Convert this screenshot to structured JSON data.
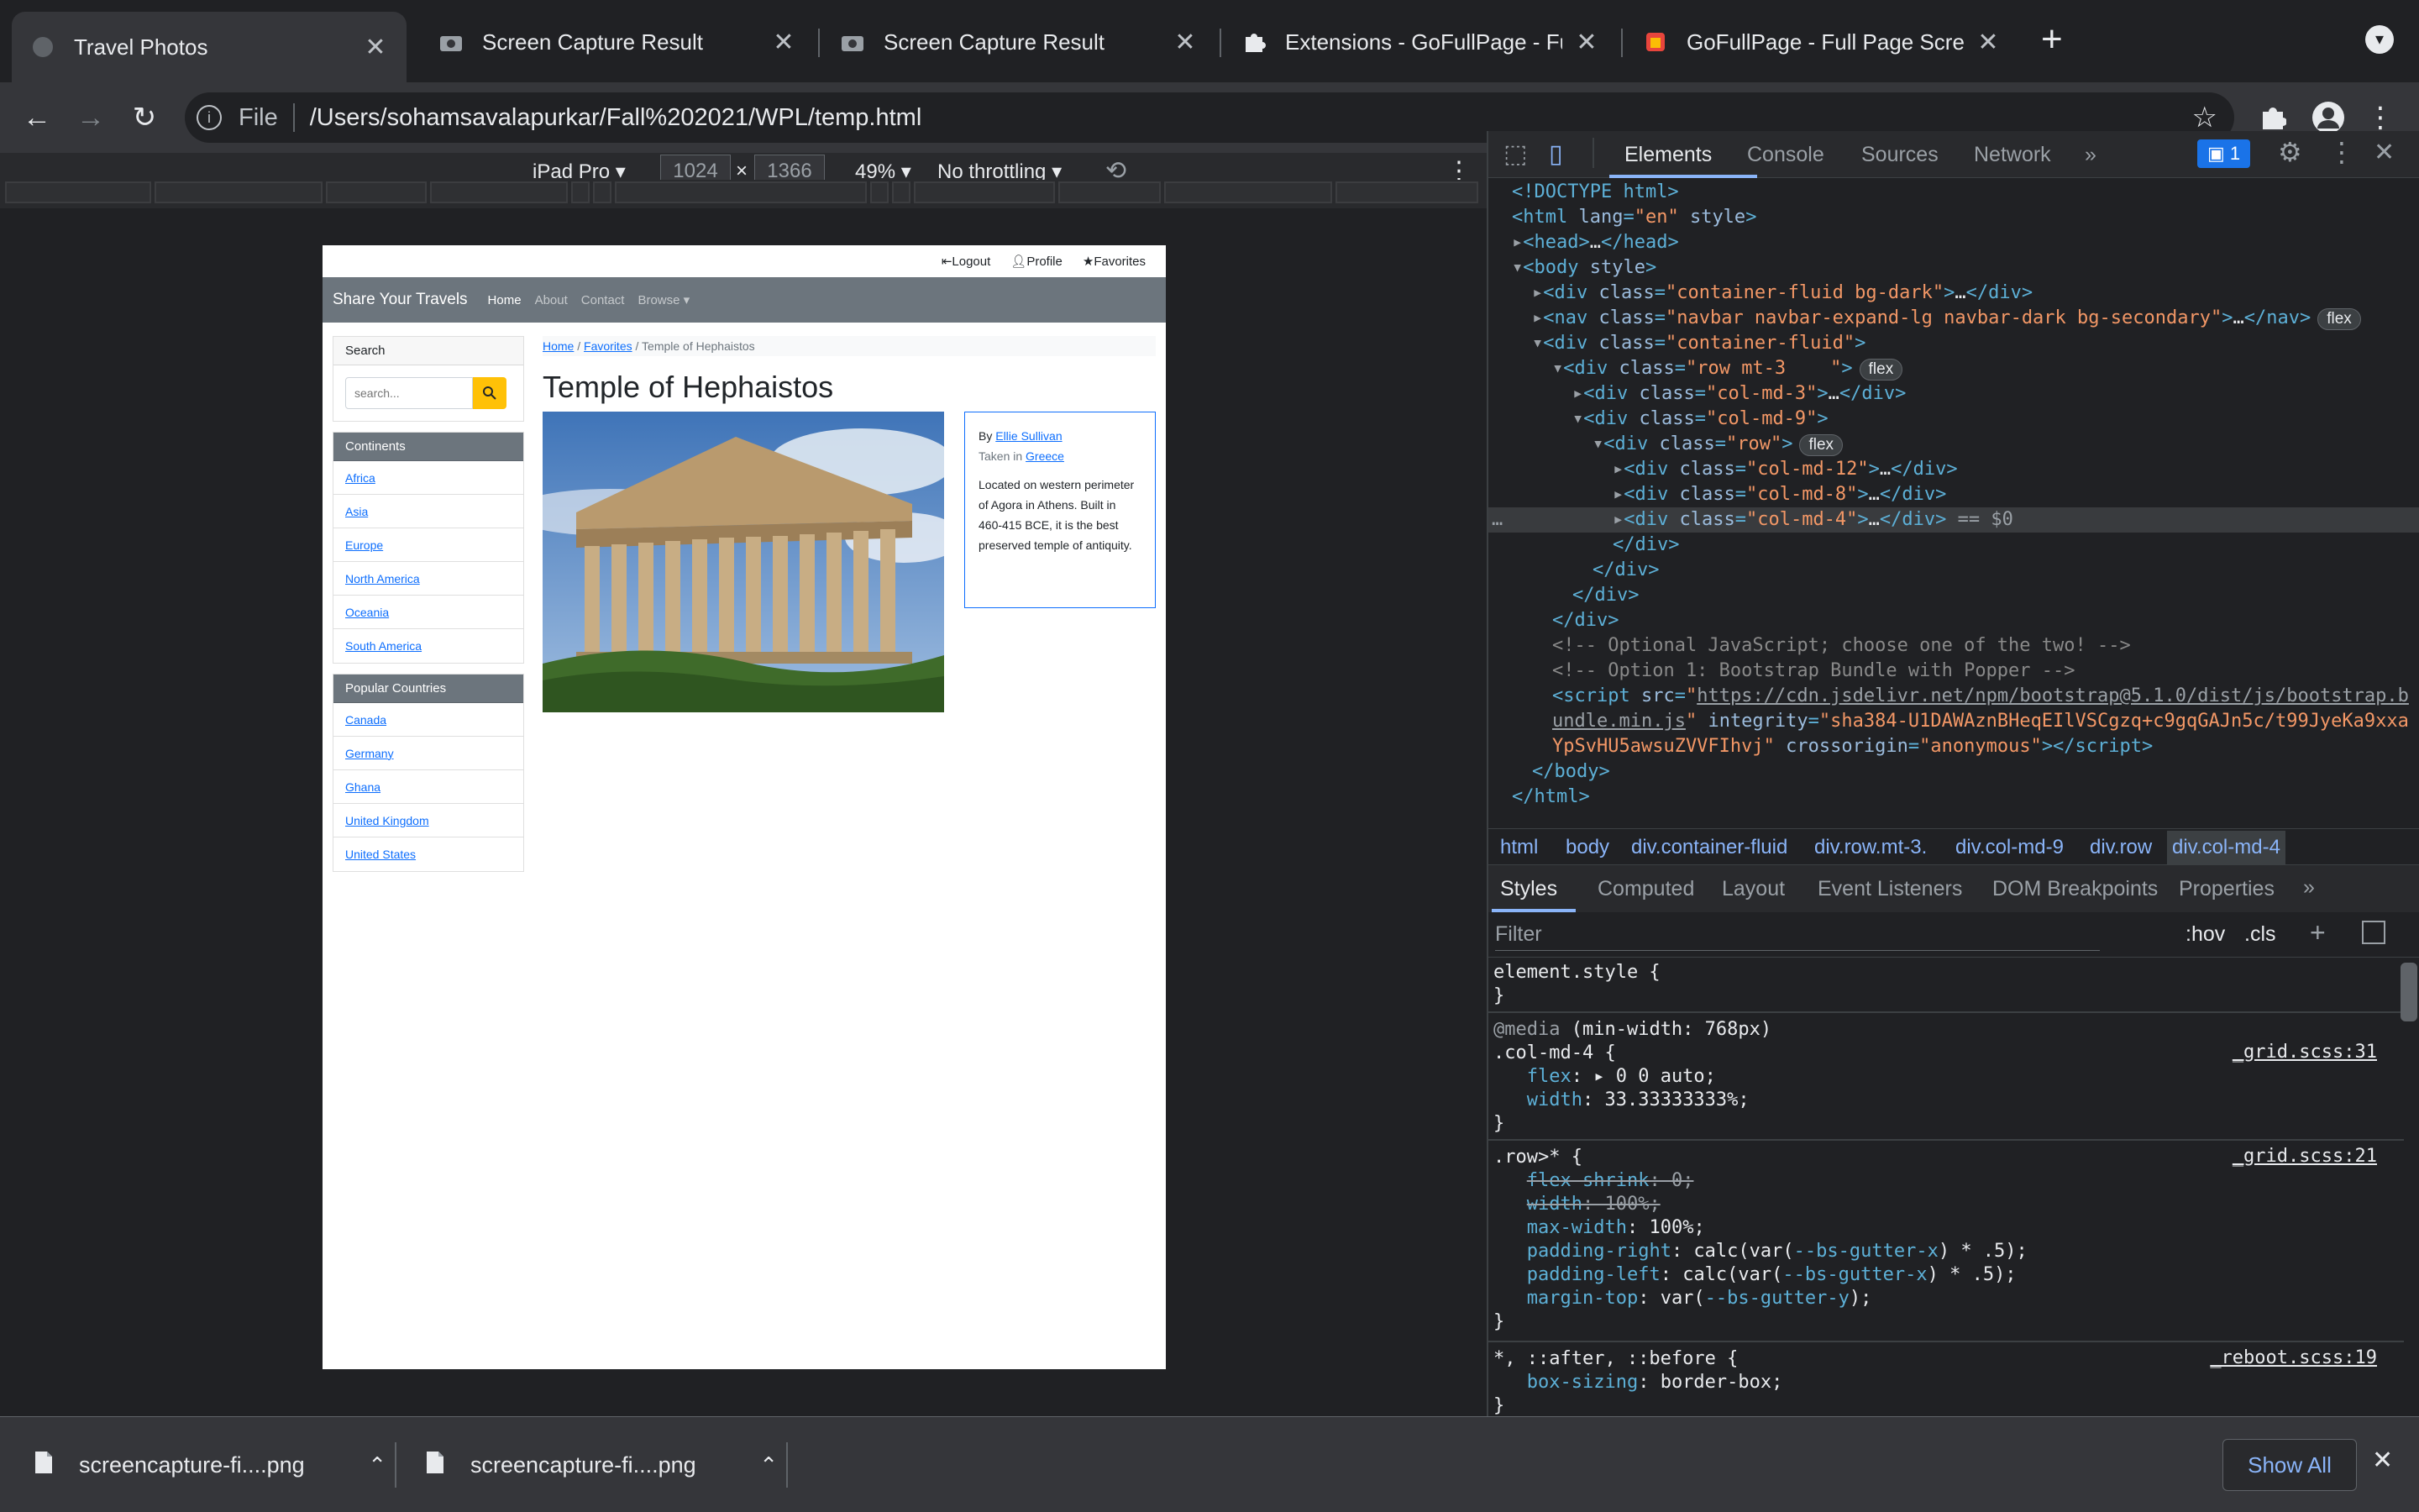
{
  "tabs": [
    {
      "title": "Travel Photos",
      "icon": "globe-icon",
      "active": true
    },
    {
      "title": "Screen Capture Result",
      "icon": "camera-icon"
    },
    {
      "title": "Screen Capture Result",
      "icon": "camera-icon"
    },
    {
      "title": "Extensions - GoFullPage - Full",
      "icon": "puzzle-icon"
    },
    {
      "title": "GoFullPage - Full Page Screen",
      "icon": "gofullpage-icon"
    }
  ],
  "omnibox": {
    "scheme": "File",
    "url": "/Users/sohamsavalapurkar/Fall%202021/WPL/temp.html"
  },
  "device": {
    "name": "iPad Pro",
    "width": "1024",
    "height": "1366",
    "zoom": "49%",
    "throttle": "No throttling"
  },
  "site": {
    "topbar": {
      "logout": "Logout",
      "profile": "Profile",
      "favorites": "Favorites"
    },
    "brand": "Share Your Travels",
    "nav": [
      "Home",
      "About",
      "Contact",
      "Browse"
    ],
    "search": {
      "header": "Search",
      "placeholder": "search..."
    },
    "continents": {
      "header": "Continents",
      "items": [
        "Africa",
        "Asia",
        "Europe",
        "North America",
        "Oceania",
        "South America"
      ]
    },
    "countries": {
      "header": "Popular Countries",
      "items": [
        "Canada",
        "Germany",
        "Ghana",
        "United Kingdom",
        "United States"
      ]
    },
    "breadcrumb": {
      "home": "Home",
      "favorites": "Favorites",
      "current": "Temple of Hephaistos"
    },
    "title": "Temple of Hephaistos",
    "info": {
      "by": "By",
      "author": "Ellie Sullivan",
      "taken": "Taken in",
      "place": "Greece",
      "description": "Located on western perimeter of Agora in Athens. Built in 460-415 BCE, it is the best preserved temple of antiquity."
    }
  },
  "devtools": {
    "tabs": [
      "Elements",
      "Console",
      "Sources",
      "Network"
    ],
    "issues": "1",
    "crumbs": [
      "html",
      "body",
      "div.container-fluid",
      "div.row.mt-3.",
      "div.col-md-9",
      "div.row",
      "div.col-md-4"
    ],
    "subtabs": [
      "Styles",
      "Computed",
      "Layout",
      "Event Listeners",
      "DOM Breakpoints",
      "Properties"
    ],
    "filter": "Filter",
    "hov": ":hov",
    "cls": ".cls"
  },
  "downloads": {
    "items": [
      "screencapture-fi....png",
      "screencapture-fi....png"
    ],
    "show_all": "Show All"
  }
}
